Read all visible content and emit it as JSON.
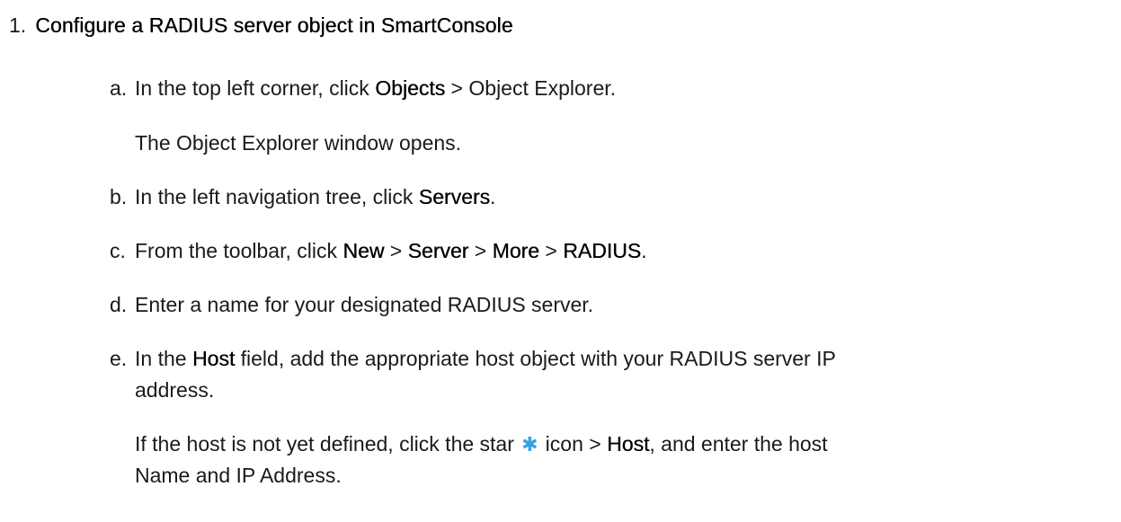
{
  "step": {
    "number": "1.",
    "title": "Configure a RADIUS server object in SmartConsole"
  },
  "substeps": {
    "a": {
      "letter": "a.",
      "text1": "In the top left corner, click ",
      "bold1": "Objects",
      "text2": " > Object Explorer.",
      "note": "The Object Explorer window opens."
    },
    "b": {
      "letter": "b.",
      "text1": "In the left navigation tree, click ",
      "bold1": "Servers",
      "text2": "."
    },
    "c": {
      "letter": "c.",
      "text1": "From the toolbar, click ",
      "bold1": "New",
      "sep1": " > ",
      "bold2": "Server",
      "sep2": " > ",
      "bold3": "More",
      "sep3": " > ",
      "bold4": "RADIUS",
      "text2": "."
    },
    "d": {
      "letter": "d.",
      "text1": "Enter a name for your designated RADIUS server."
    },
    "e": {
      "letter": "e.",
      "text1": "In the ",
      "bold1": "Host",
      "text2": " field, add the appropriate host object with your RADIUS server IP",
      "line2": "address.",
      "note_text1": "If the host is not yet defined, click the star ",
      "note_icon": "star-icon",
      "note_text2": " icon > ",
      "note_bold1": "Host",
      "note_text3": ", and enter the host",
      "note_line2": "Name and IP Address."
    }
  },
  "colors": {
    "text": "#1a1a1a",
    "star_icon": "#3aa0e6"
  }
}
